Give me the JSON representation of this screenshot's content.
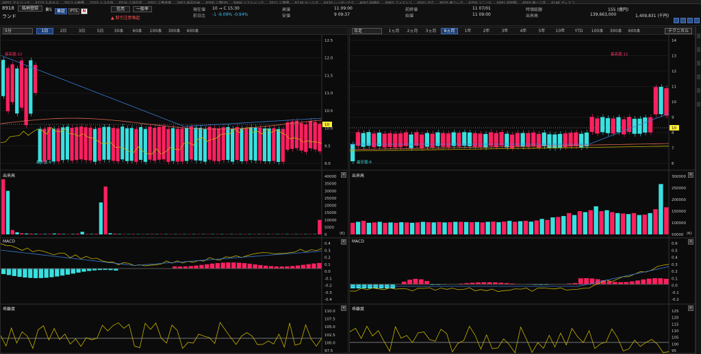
{
  "ticker": [
    "6857 アドバンテ",
    "6723 ルネサス",
    "7012 川崎重",
    "7203 トヨタ自",
    "8316 三井住友",
    "9301 三菱倉庫",
    "7453 良品計画",
    "8306 三菱UFJ",
    "9984 ソフトバンク",
    "7011 三菱重",
    "8136 サンリオ",
    "6920 レーザーテク",
    "4063 信越化",
    "9983 ファストリ",
    "6501 日立",
    "8035 東エレク",
    "6758 ソニーG",
    "6981 村田製",
    "4568 第一三共",
    "6146 ディスコ"
  ],
  "header": {
    "code": "8918",
    "name": "ランド",
    "watchlist_btn": "銘柄登録",
    "market": "東S",
    "exchange_btn": "東証",
    "pts_btn": "PTS",
    "n_badge": "N",
    "credit_btn": "信用",
    "general_btn": "一般率",
    "warning": "取引注意喚起",
    "fields": [
      {
        "label": "現在値",
        "value": "10 → C  15:30"
      },
      {
        "label": "前日比",
        "value": "-1  -9.09%   -0.94%"
      },
      {
        "label": "高値",
        "value": "11 09:00"
      },
      {
        "label": "安値",
        "value": "9 09:37"
      },
      {
        "label": "前終値",
        "value": "11 07/01"
      },
      {
        "label": "始値",
        "value": "11 09:00"
      },
      {
        "label": "時価総額",
        "value": "155 (億円)"
      },
      {
        "label": "出来高",
        "value": "139,663,000"
      },
      {
        "label": "",
        "value": "1,409,831 (千円)"
      }
    ]
  },
  "left": {
    "period_select": "5分",
    "tabs": [
      "1日",
      "2日",
      "3日",
      "5日",
      "30本",
      "60本",
      "100本",
      "300本",
      "600本"
    ],
    "active_tab": "1日",
    "price_axis": [
      "12.5",
      "12.0",
      "11.5",
      "11.0",
      "10.5",
      "10.0",
      "9.5",
      "9.0"
    ],
    "current_price": "10",
    "max_label": "最高値:12",
    "min_label": "最安値:9",
    "volume_label": "出来高",
    "volume_axis": [
      "40000",
      "35000",
      "30000",
      "25000",
      "20000",
      "15000",
      "10000",
      "5000",
      "0"
    ],
    "macd_label": "MACD",
    "macd_axis": [
      "0.4",
      "0.3",
      "0.2",
      "0.1",
      "0.0",
      "-0.1",
      "-0.2",
      "-0.3",
      "-0.4"
    ],
    "osc_label": "乖離度",
    "osc_axis": [
      "110.0",
      "107.5",
      "105.0",
      "102.5",
      "100.0",
      "97.5"
    ],
    "volumes": [
      38000,
      30000,
      3000,
      1500,
      800,
      600,
      500,
      400,
      300,
      300,
      300,
      600,
      500,
      300,
      200,
      300,
      500,
      1800,
      300,
      300,
      400,
      22000,
      33000,
      800,
      500,
      300,
      200,
      200,
      300,
      200,
      200,
      200,
      300,
      200,
      200,
      200,
      200,
      200,
      200,
      200,
      200,
      200,
      200,
      200,
      200,
      200,
      200,
      200,
      200,
      200,
      200,
      200,
      200,
      200,
      200,
      200,
      200,
      200,
      200,
      200,
      200,
      200,
      200,
      200,
      200,
      200,
      200,
      200,
      10000
    ]
  },
  "right": {
    "period_select": "日足",
    "tabs": [
      "1ヵ月",
      "2ヵ月",
      "3ヵ月",
      "6ヵ月",
      "1年",
      "2年",
      "3年",
      "4年",
      "5年",
      "10年",
      "YTD",
      "100本",
      "300本",
      "600本"
    ],
    "active_tab": "6ヵ月",
    "tech_button": "テクニカル",
    "price_axis": [
      "14",
      "13",
      "12",
      "11",
      "10",
      "9",
      "8",
      "7",
      "6"
    ],
    "current_price": "10",
    "max_label": "最高値:12",
    "min_label": "最安値:6",
    "volume_label": "出来高",
    "volume_axis": [
      "300000",
      "250000",
      "200000",
      "150000",
      "100000",
      "50000"
    ],
    "macd_label": "MACD",
    "macd_axis": [
      "0.6",
      "0.5",
      "0.4",
      "0.3",
      "0.2",
      "0.1",
      "0.0",
      "-0.1",
      "-0.2"
    ],
    "osc_label": "乖離度",
    "osc_axis": [
      "125",
      "120",
      "115",
      "110",
      "105",
      "100",
      "95"
    ],
    "volumes": [
      60000,
      65000,
      70000,
      60000,
      62000,
      65000,
      60000,
      62000,
      60000,
      63000,
      62000,
      60000,
      62000,
      65000,
      63000,
      62000,
      64000,
      62000,
      63000,
      65000,
      65000,
      64000,
      63000,
      64000,
      62000,
      65000,
      66000,
      63000,
      66000,
      70000,
      65000,
      68000,
      70000,
      66000,
      72000,
      80000,
      75000,
      88000,
      90000,
      95000,
      110000,
      100000,
      120000,
      115000,
      125000,
      145000,
      120000,
      125000,
      115000,
      110000,
      108000,
      105000,
      110000,
      100000,
      102000,
      110000,
      130000,
      260000,
      140000
    ]
  },
  "x_label": "(K)"
}
